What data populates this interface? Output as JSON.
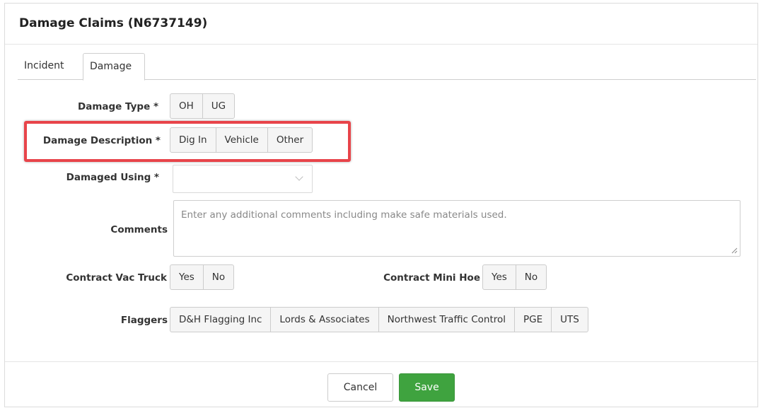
{
  "dialog": {
    "title": "Damage Claims (N6737149)"
  },
  "tabs": [
    {
      "label": "Incident"
    },
    {
      "label": "Damage"
    }
  ],
  "form": {
    "damage_type": {
      "label": "Damage Type *",
      "options": [
        "OH",
        "UG"
      ]
    },
    "damage_description": {
      "label": "Damage Description *",
      "options": [
        "Dig In",
        "Vehicle",
        "Other"
      ]
    },
    "damaged_using": {
      "label": "Damaged Using *",
      "value": ""
    },
    "comments": {
      "label": "Comments",
      "placeholder": "Enter any additional comments including make safe materials used."
    },
    "contract_vac_truck": {
      "label": "Contract Vac Truck",
      "options": [
        "Yes",
        "No"
      ]
    },
    "contract_mini_hoe": {
      "label": "Contract Mini Hoe",
      "options": [
        "Yes",
        "No"
      ]
    },
    "flaggers": {
      "label": "Flaggers",
      "options": [
        "D&H Flagging Inc",
        "Lords & Associates",
        "Northwest Traffic Control",
        "PGE",
        "UTS"
      ]
    }
  },
  "footer": {
    "cancel_label": "Cancel",
    "save_label": "Save"
  },
  "colors": {
    "highlight": "#e8444a",
    "save_button": "#3fa33f"
  },
  "icons": {
    "select_chevron": "chevron-down-icon",
    "resize_handle": "resize-handle-icon"
  }
}
